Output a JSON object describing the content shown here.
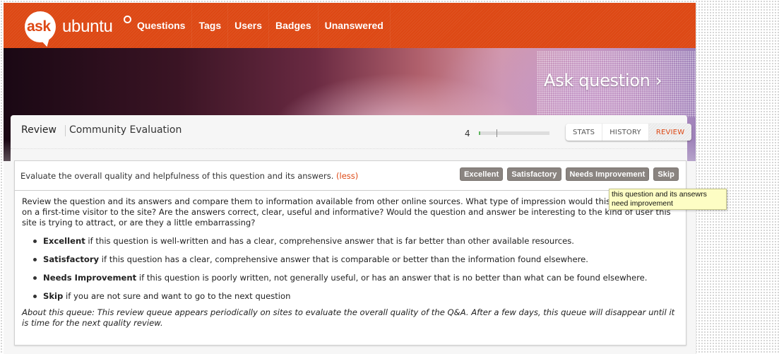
{
  "site": {
    "logo_ask": "ask",
    "logo_ubuntu": "ubuntu",
    "brand_color": "#dd4814"
  },
  "nav": {
    "items": [
      {
        "label": "Questions"
      },
      {
        "label": "Tags"
      },
      {
        "label": "Users"
      },
      {
        "label": "Badges"
      },
      {
        "label": "Unanswered"
      }
    ]
  },
  "hero": {
    "ask_label": "Ask question",
    "ask_chevron": "›"
  },
  "review": {
    "breadcrumb_root": "Review",
    "title": "Community Evaluation",
    "progress": {
      "count": "4",
      "fill_fraction": 0.02,
      "marker_fraction": 0.25
    },
    "tabs": [
      {
        "label": "STATS",
        "active": false
      },
      {
        "label": "HISTORY",
        "active": false
      },
      {
        "label": "REVIEW",
        "active": true
      }
    ]
  },
  "task": {
    "instruction": "Evaluate the overall quality and helpfulness of this question and its answers.",
    "less_link": "(less)",
    "actions": [
      {
        "label": "Excellent"
      },
      {
        "label": "Satisfactory"
      },
      {
        "label": "Needs Improvement"
      },
      {
        "label": "Skip"
      }
    ],
    "intro": "Review the question and its answers and compare them to information available from other online sources. What type of impression would this question make on a first-time visitor to the site? Are the answers correct, clear, useful and informative? Would the question and answer be interesting to the kind of user this site is trying to attract, or are they a little embarrassing?",
    "options": [
      {
        "term": "Excellent",
        "text": " if this question is well-written and has a clear, comprehensive answer that is far better than other available resources."
      },
      {
        "term": "Satisfactory",
        "text": " if this question has a clear, comprehensive answer that is comparable or better than the information found elsewhere."
      },
      {
        "term": "Needs Improvement",
        "text": " if this question is poorly written, not generally useful, or has an answer that is no better than what can be found elsewhere."
      },
      {
        "term": "Skip",
        "text": " if you are not sure and want to go to the next question"
      }
    ],
    "about": "About this queue: This review queue appears periodically on sites to evaluate the overall quality of the Q&A. After a few days, this queue will disappear until it is time for the next quality review."
  },
  "tooltip": {
    "text": "this question and its ansewrs need improvement"
  }
}
